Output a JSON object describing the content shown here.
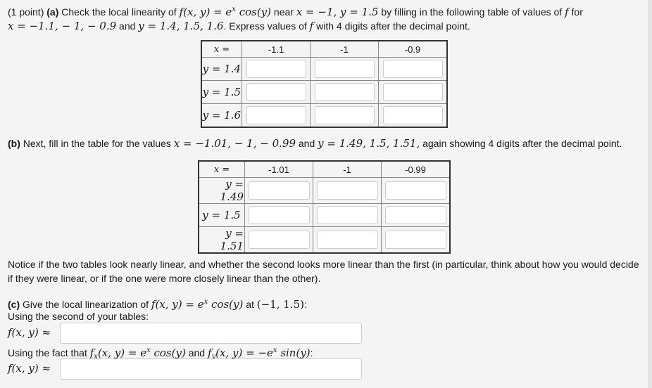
{
  "part_a": {
    "points_label": "(1 point)",
    "part_label": "(a)",
    "text1": " Check the local linearity of ",
    "func": "f(x, y) = e",
    "func_sup": "x",
    "func_tail": " cos(y)",
    "text2": " near ",
    "point": "x = −1,  y = 1.5",
    "text3": " by filling in the following table of values of ",
    "f": "f",
    "text4": " for",
    "xvals": "x = −1.1,  − 1,  − 0.9",
    "and": " and ",
    "yvals": "y = 1.4,  1.5,  1.6",
    "text5": ". Express values of ",
    "text6": " with 4 digits after the decimal point."
  },
  "table1": {
    "x_header": "x =",
    "columns": [
      "-1.1",
      "-1",
      "-0.9"
    ],
    "rows": [
      {
        "label": "y = 1.4",
        "values": [
          "",
          "",
          ""
        ]
      },
      {
        "label": "y = 1.5",
        "values": [
          "",
          "",
          ""
        ]
      },
      {
        "label": "y = 1.6",
        "values": [
          "",
          "",
          ""
        ]
      }
    ]
  },
  "part_b": {
    "part_label": "(b)",
    "text1": " Next, fill in the table for the values ",
    "xvals": "x = −1.01,  − 1,  − 0.99",
    "and": " and ",
    "yvals": "y = 1.49,  1.5,  1.51,",
    "text2": " again showing 4 digits after the decimal point."
  },
  "table2": {
    "x_header": "x =",
    "columns": [
      "-1.01",
      "-1",
      "-0.99"
    ],
    "rows": [
      {
        "label": "y = 1.49",
        "values": [
          "",
          "",
          ""
        ]
      },
      {
        "label": "y = 1.5",
        "values": [
          "",
          "",
          ""
        ]
      },
      {
        "label": "y = 1.51",
        "values": [
          "",
          "",
          ""
        ]
      }
    ]
  },
  "notice": {
    "line1": "Notice if the two tables look nearly linear, and whether the second looks more linear than the first (in particular, think about how you would decide",
    "line2": "if they were linear, or if the one were more closely linear than the other)."
  },
  "part_c": {
    "part_label": "(c)",
    "text1": " Give the local linearization of ",
    "func": "f(x, y) = e",
    "func_sup": "x",
    "func_tail": " cos(y)",
    "text2": " at ",
    "point": "(−1, 1.5)",
    "text3": ":",
    "using_second": "Using the second of your tables:",
    "approx_label": "f(x, y) ≈",
    "answer1": "",
    "using_fact_prefix": "Using the fact that ",
    "fx": "f",
    "fx_sub": "x",
    "fx_rest": "(x, y) = e",
    "fx_sup": "x",
    "fx_tail": " cos(y)",
    "and": " and ",
    "fy": "f",
    "fy_sub": "y",
    "fy_rest": "(x, y) = −e",
    "fy_sup": "x",
    "fy_tail": " sin(y)",
    "colon": ":",
    "answer2": ""
  }
}
